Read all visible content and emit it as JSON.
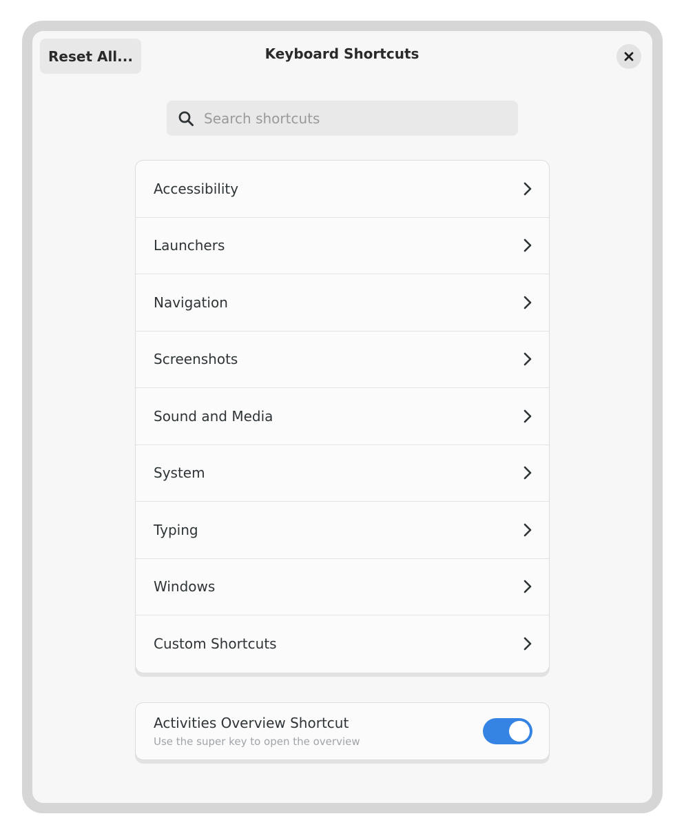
{
  "header": {
    "reset_label": "Reset All...",
    "title": "Keyboard Shortcuts",
    "close_icon": "close-icon"
  },
  "search": {
    "placeholder": "Search shortcuts",
    "value": "",
    "icon": "search-icon"
  },
  "categories": [
    {
      "label": "Accessibility",
      "icon": "chevron-right-icon"
    },
    {
      "label": "Launchers",
      "icon": "chevron-right-icon"
    },
    {
      "label": "Navigation",
      "icon": "chevron-right-icon"
    },
    {
      "label": "Screenshots",
      "icon": "chevron-right-icon"
    },
    {
      "label": "Sound and Media",
      "icon": "chevron-right-icon"
    },
    {
      "label": "System",
      "icon": "chevron-right-icon"
    },
    {
      "label": "Typing",
      "icon": "chevron-right-icon"
    },
    {
      "label": "Windows",
      "icon": "chevron-right-icon"
    },
    {
      "label": "Custom Shortcuts",
      "icon": "chevron-right-icon"
    }
  ],
  "overview": {
    "title": "Activities Overview Shortcut",
    "subtitle": "Use the super key to open the overview",
    "enabled": true
  },
  "colors": {
    "accent": "#3584e4",
    "background": "#f7f7f7",
    "frame": "#d6d6d6"
  }
}
